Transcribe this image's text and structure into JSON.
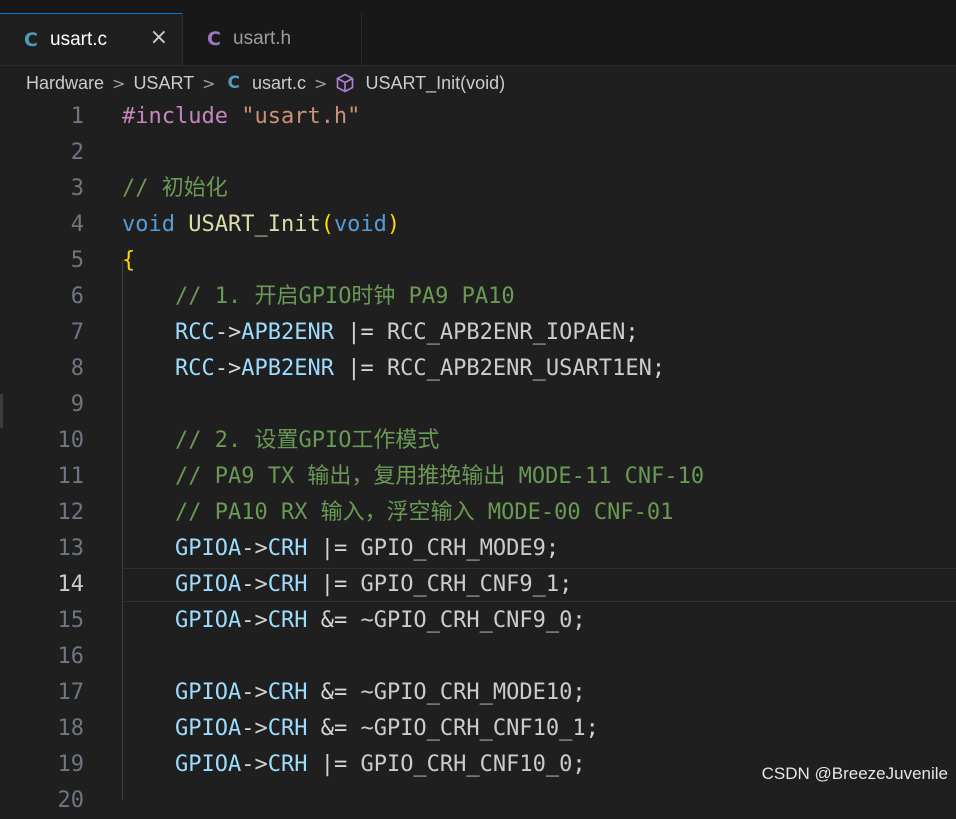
{
  "tabs": [
    {
      "label": "usart.c",
      "icon": "C",
      "active": true,
      "close": "×"
    },
    {
      "label": "usart.h",
      "icon": "C",
      "active": false
    }
  ],
  "breadcrumb": {
    "items": [
      "Hardware",
      "USART",
      "usart.c",
      "USART_Init(void)"
    ],
    "separator": ">",
    "file_icon": "C"
  },
  "editor": {
    "current_line": 14,
    "line_numbers": [
      "1",
      "2",
      "3",
      "4",
      "5",
      "6",
      "7",
      "8",
      "9",
      "10",
      "11",
      "12",
      "13",
      "14",
      "15",
      "16",
      "17",
      "18",
      "19",
      "20"
    ],
    "lines": [
      {
        "tokens": [
          [
            "#include ",
            "pre"
          ],
          [
            "\"usart.h\"",
            "str"
          ]
        ]
      },
      {
        "tokens": []
      },
      {
        "tokens": [
          [
            "// 初始化",
            "com"
          ]
        ]
      },
      {
        "tokens": [
          [
            "void",
            "kw"
          ],
          [
            " ",
            "op"
          ],
          [
            "USART_Init",
            "fn"
          ],
          [
            "(",
            "br"
          ],
          [
            "void",
            "kw"
          ],
          [
            ")",
            "br"
          ]
        ]
      },
      {
        "tokens": [
          [
            "{",
            "br"
          ]
        ]
      },
      {
        "tokens": [
          [
            "    ",
            "op"
          ],
          [
            "// 1. 开启GPIO时钟 PA9 PA10",
            "com"
          ]
        ]
      },
      {
        "tokens": [
          [
            "    ",
            "op"
          ],
          [
            "RCC",
            "var"
          ],
          [
            "->",
            "op"
          ],
          [
            "APB2ENR",
            "var"
          ],
          [
            " |= ",
            "op"
          ],
          [
            "RCC_APB2ENR_IOPAEN",
            "mac"
          ],
          [
            ";",
            "op"
          ]
        ]
      },
      {
        "tokens": [
          [
            "    ",
            "op"
          ],
          [
            "RCC",
            "var"
          ],
          [
            "->",
            "op"
          ],
          [
            "APB2ENR",
            "var"
          ],
          [
            " |= ",
            "op"
          ],
          [
            "RCC_APB2ENR_USART1EN",
            "mac"
          ],
          [
            ";",
            "op"
          ]
        ]
      },
      {
        "tokens": []
      },
      {
        "tokens": [
          [
            "    ",
            "op"
          ],
          [
            "// 2. 设置GPIO工作模式",
            "com"
          ]
        ]
      },
      {
        "tokens": [
          [
            "    ",
            "op"
          ],
          [
            "// PA9 TX 输出，复用推挽输出 MODE-11 CNF-10",
            "com"
          ]
        ]
      },
      {
        "tokens": [
          [
            "    ",
            "op"
          ],
          [
            "// PA10 RX 输入，浮空输入 MODE-00 CNF-01",
            "com"
          ]
        ]
      },
      {
        "tokens": [
          [
            "    ",
            "op"
          ],
          [
            "GPIOA",
            "var"
          ],
          [
            "->",
            "op"
          ],
          [
            "CRH",
            "var"
          ],
          [
            " |= ",
            "op"
          ],
          [
            "GPIO_CRH_MODE9",
            "mac"
          ],
          [
            ";",
            "op"
          ]
        ]
      },
      {
        "tokens": [
          [
            "    ",
            "op"
          ],
          [
            "GPIOA",
            "var"
          ],
          [
            "->",
            "op"
          ],
          [
            "CRH",
            "var"
          ],
          [
            " |= ",
            "op"
          ],
          [
            "GPIO_CRH_CNF9_1",
            "mac"
          ],
          [
            ";",
            "op"
          ]
        ]
      },
      {
        "tokens": [
          [
            "    ",
            "op"
          ],
          [
            "GPIOA",
            "var"
          ],
          [
            "->",
            "op"
          ],
          [
            "CRH",
            "var"
          ],
          [
            " &= ",
            "op"
          ],
          [
            "~GPIO_CRH_CNF9_0",
            "mac"
          ],
          [
            ";",
            "op"
          ]
        ]
      },
      {
        "tokens": []
      },
      {
        "tokens": [
          [
            "    ",
            "op"
          ],
          [
            "GPIOA",
            "var"
          ],
          [
            "->",
            "op"
          ],
          [
            "CRH",
            "var"
          ],
          [
            " &= ",
            "op"
          ],
          [
            "~GPIO_CRH_MODE10",
            "mac"
          ],
          [
            ";",
            "op"
          ]
        ]
      },
      {
        "tokens": [
          [
            "    ",
            "op"
          ],
          [
            "GPIOA",
            "var"
          ],
          [
            "->",
            "op"
          ],
          [
            "CRH",
            "var"
          ],
          [
            " &= ",
            "op"
          ],
          [
            "~GPIO_CRH_CNF10_1",
            "mac"
          ],
          [
            ";",
            "op"
          ]
        ]
      },
      {
        "tokens": [
          [
            "    ",
            "op"
          ],
          [
            "GPIOA",
            "var"
          ],
          [
            "->",
            "op"
          ],
          [
            "CRH",
            "var"
          ],
          [
            " |= ",
            "op"
          ],
          [
            "GPIO_CRH_CNF10_0",
            "mac"
          ],
          [
            ";",
            "op"
          ]
        ]
      },
      {
        "tokens": []
      }
    ]
  },
  "watermark": "CSDN @BreezeJuvenile",
  "colors": {
    "background": "#1f1f1f",
    "accent": "#0078d4",
    "comment": "#6a9955",
    "keyword": "#569cd6",
    "function": "#dcdcaa",
    "variable": "#9cdcfe",
    "string": "#ce9178",
    "preprocessor": "#c586c0"
  },
  "icons": {
    "file_c_icon": "c-language-icon",
    "close_icon": "close-icon",
    "symbol_icon": "cube-method-icon"
  }
}
